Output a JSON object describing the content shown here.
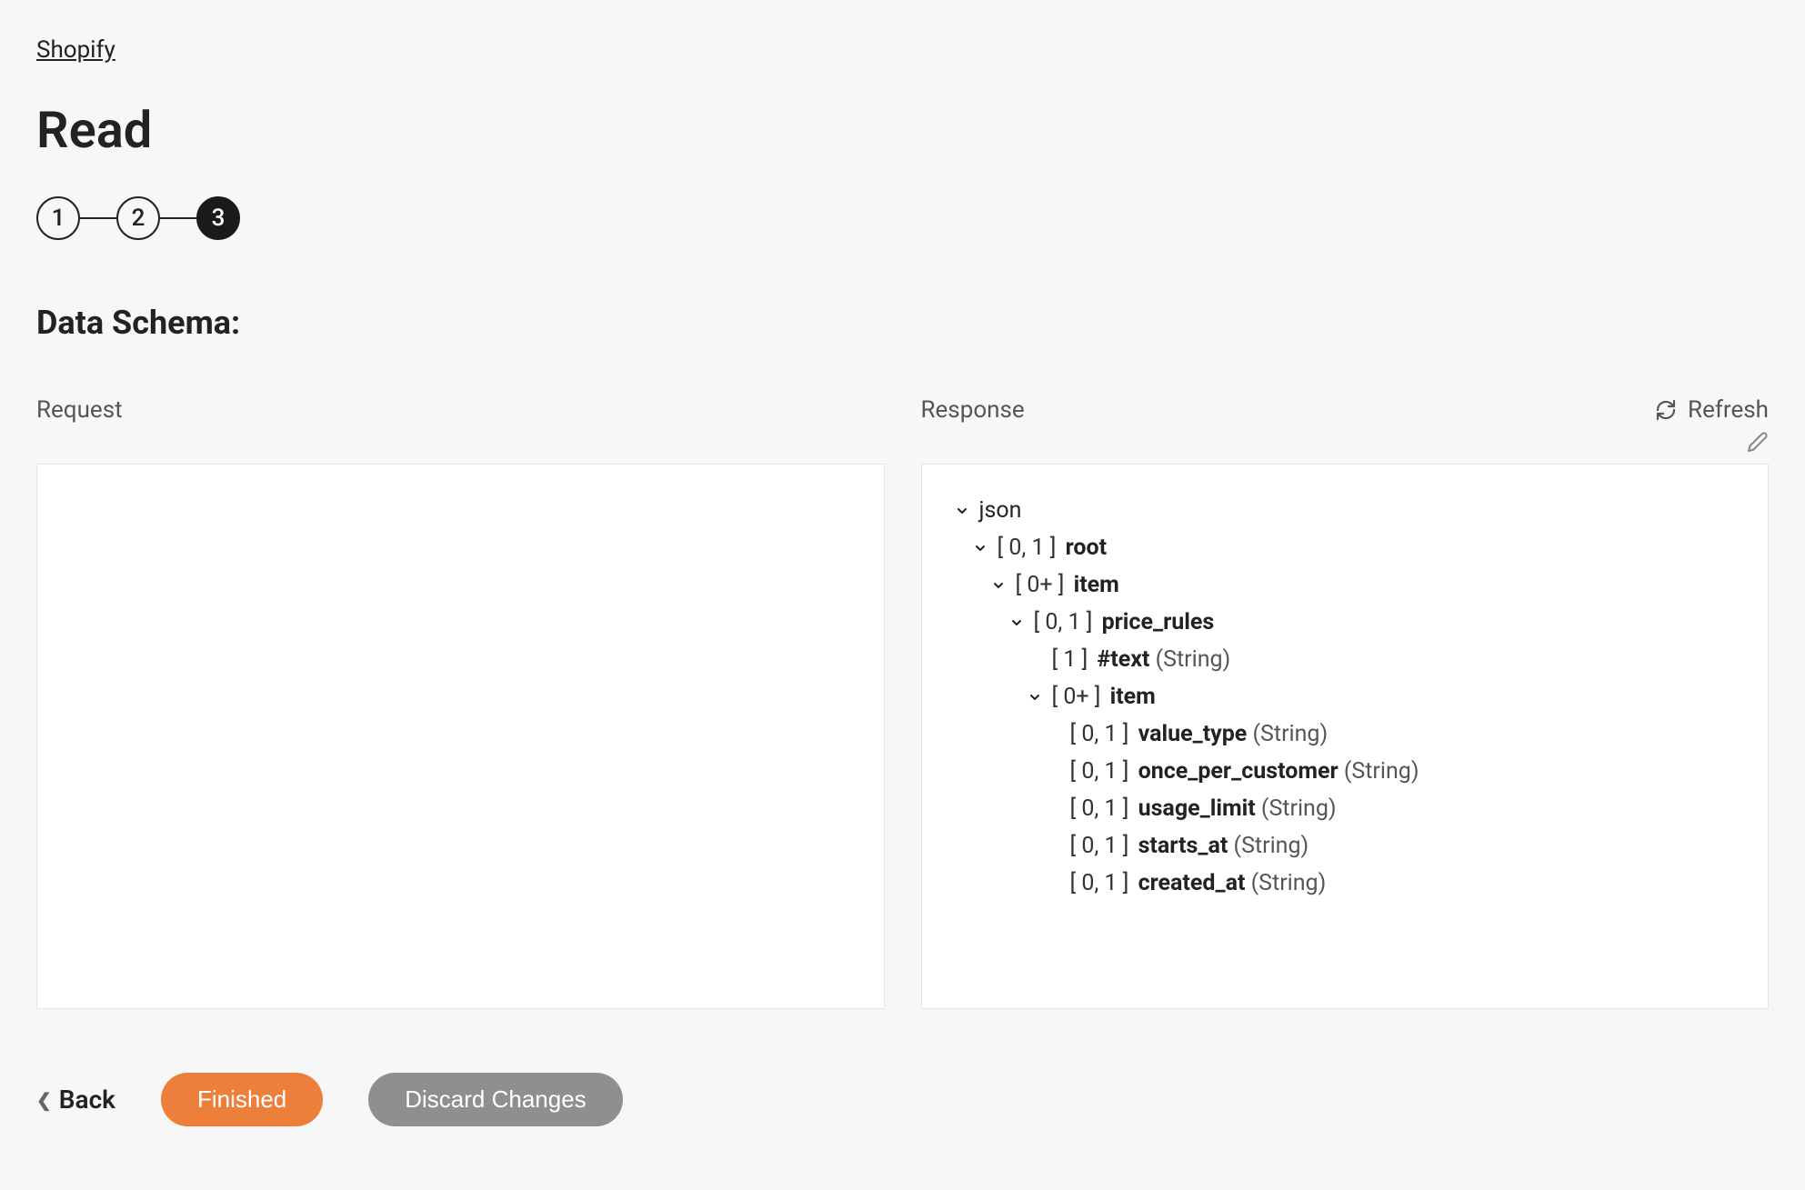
{
  "breadcrumb": "Shopify",
  "title": "Read",
  "stepper": {
    "steps": [
      "1",
      "2",
      "3"
    ],
    "activeIndex": 2
  },
  "section_title": "Data Schema:",
  "labels": {
    "request": "Request",
    "response": "Response",
    "refresh": "Refresh"
  },
  "tree": [
    {
      "indent": 0,
      "collapsible": true,
      "range": "",
      "name": "json",
      "nameBold": false,
      "type": ""
    },
    {
      "indent": 1,
      "collapsible": true,
      "range": "[ 0, 1 ]",
      "name": "root",
      "nameBold": true,
      "type": ""
    },
    {
      "indent": 2,
      "collapsible": true,
      "range": "[ 0+ ]",
      "name": "item",
      "nameBold": true,
      "type": ""
    },
    {
      "indent": 3,
      "collapsible": true,
      "range": "[ 0, 1 ]",
      "name": "price_rules",
      "nameBold": true,
      "type": ""
    },
    {
      "indent": 4,
      "collapsible": false,
      "range": "[ 1 ]",
      "name": "#text",
      "nameBold": true,
      "type": "(String)"
    },
    {
      "indent": 4,
      "collapsible": true,
      "range": "[ 0+ ]",
      "name": "item",
      "nameBold": true,
      "type": ""
    },
    {
      "indent": 5,
      "collapsible": false,
      "range": "[ 0, 1 ]",
      "name": "value_type",
      "nameBold": true,
      "type": "(String)"
    },
    {
      "indent": 5,
      "collapsible": false,
      "range": "[ 0, 1 ]",
      "name": "once_per_customer",
      "nameBold": true,
      "type": "(String)"
    },
    {
      "indent": 5,
      "collapsible": false,
      "range": "[ 0, 1 ]",
      "name": "usage_limit",
      "nameBold": true,
      "type": "(String)"
    },
    {
      "indent": 5,
      "collapsible": false,
      "range": "[ 0, 1 ]",
      "name": "starts_at",
      "nameBold": true,
      "type": "(String)"
    },
    {
      "indent": 5,
      "collapsible": false,
      "range": "[ 0, 1 ]",
      "name": "created_at",
      "nameBold": true,
      "type": "(String)"
    }
  ],
  "footer": {
    "back": "Back",
    "finished": "Finished",
    "discard": "Discard Changes"
  }
}
